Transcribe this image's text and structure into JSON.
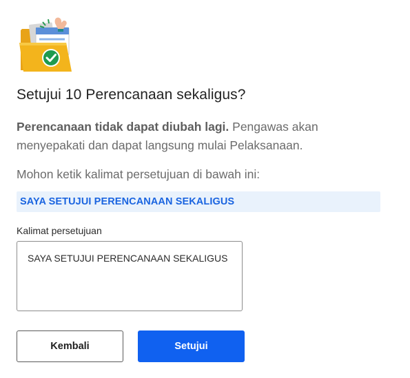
{
  "dialog": {
    "illustration_icon": "folder-approval-icon",
    "title": "Setujui 10 Perencanaan sekaligus?",
    "description_bold": "Perencanaan tidak dapat diubah lagi.",
    "description_rest": " Pengawas akan menyepakati dan dapat langsung mulai Pelaksanaan.",
    "instruction": "Mohon ketik kalimat persetujuan di bawah ini:",
    "confirmation_phrase": "SAYA SETUJUI PERENCANAAN SEKALIGUS",
    "field_label": "Kalimat persetujuan",
    "field_value": "SAYA SETUJUI PERENCANAAN SEKALIGUS",
    "back_label": "Kembali",
    "approve_label": "Setujui"
  },
  "colors": {
    "primary": "#1061f0",
    "phrase_bg": "#e9f2fc",
    "phrase_text": "#1a64e0",
    "check_green": "#1f9a4e",
    "folder_yellow": "#f3b41c"
  }
}
